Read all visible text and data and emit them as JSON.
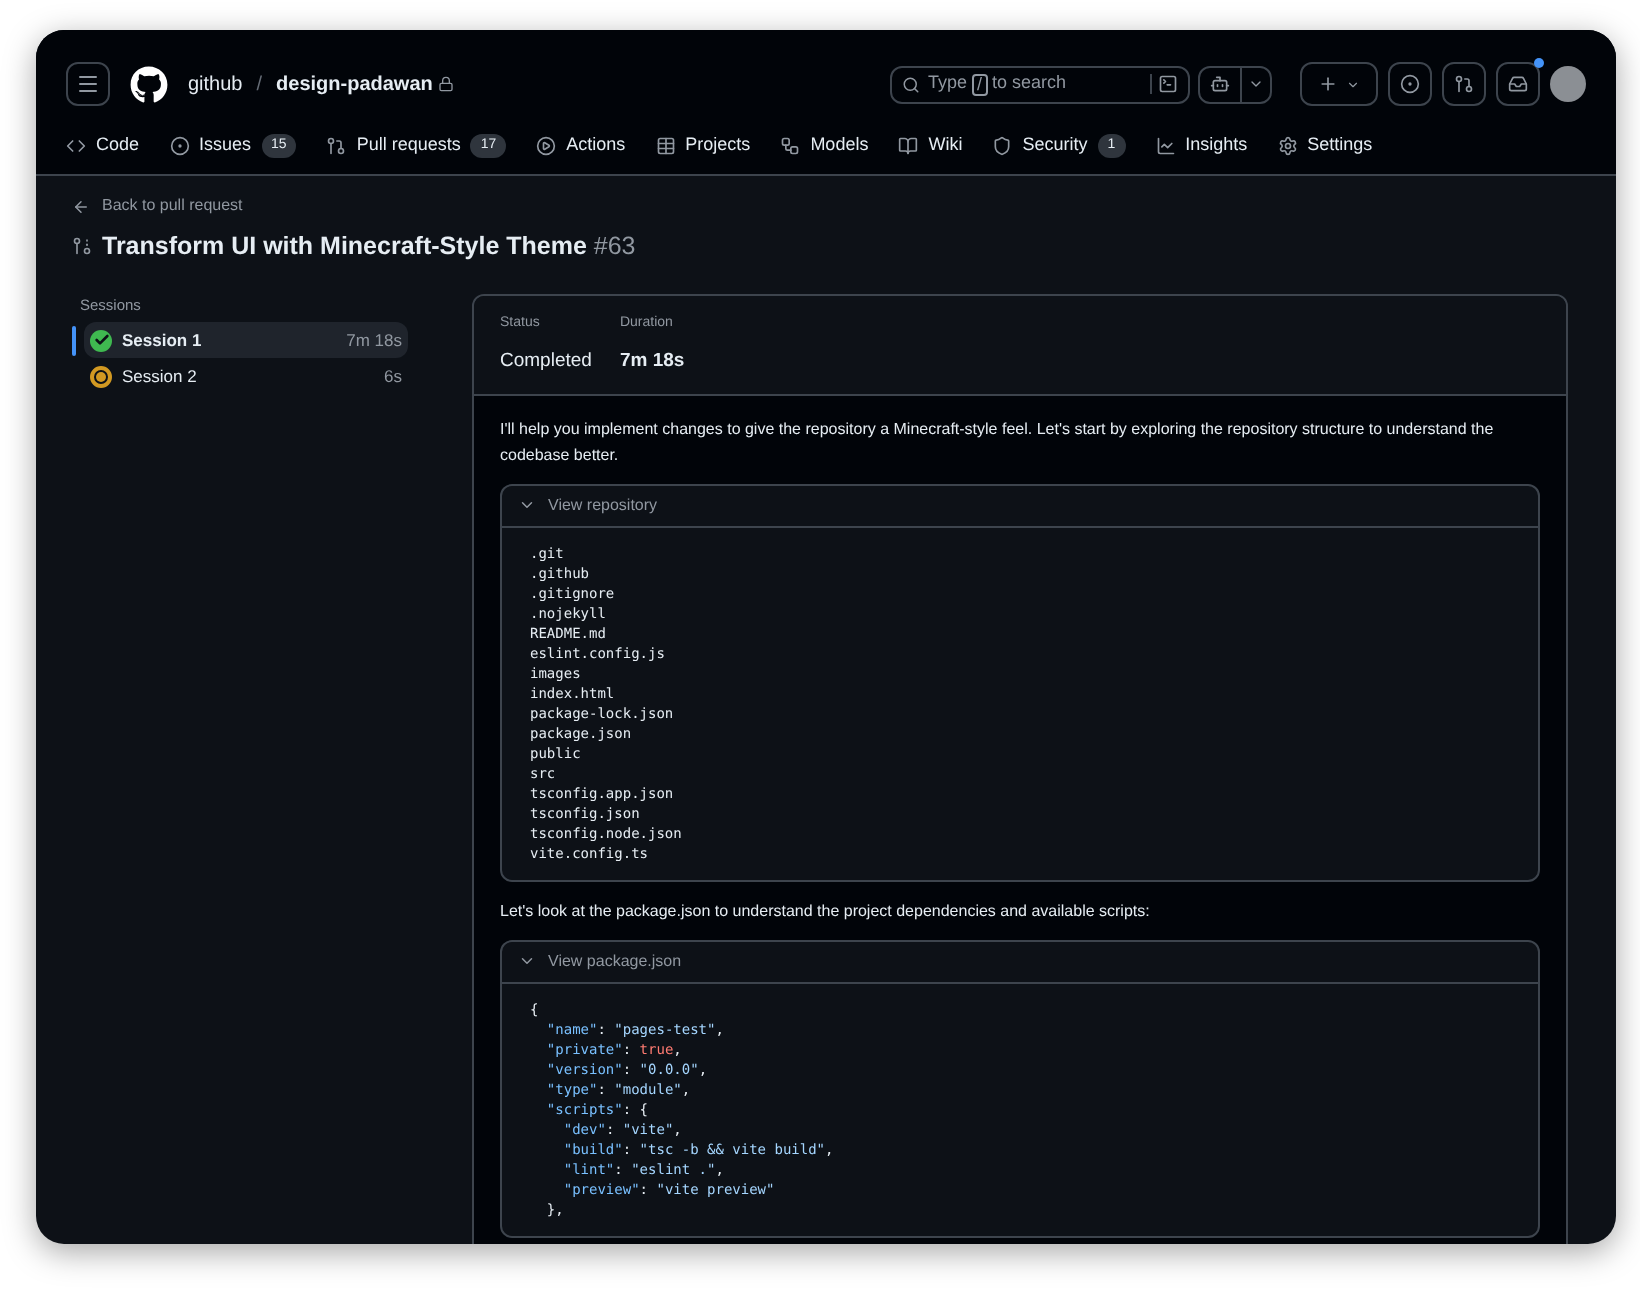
{
  "header": {
    "owner": "github",
    "separator": "/",
    "repo": "design-padawan",
    "search": {
      "before": "Type",
      "key": "/",
      "after": "to search"
    },
    "notifications_unread": true
  },
  "nav": [
    {
      "label": "Code"
    },
    {
      "label": "Issues",
      "count": "15"
    },
    {
      "label": "Pull requests",
      "count": "17"
    },
    {
      "label": "Actions"
    },
    {
      "label": "Projects"
    },
    {
      "label": "Models"
    },
    {
      "label": "Wiki"
    },
    {
      "label": "Security",
      "count": "1"
    },
    {
      "label": "Insights"
    },
    {
      "label": "Settings"
    }
  ],
  "back_link": "Back to pull request",
  "title": {
    "text": "Transform UI with Minecraft-Style Theme",
    "number": "#63"
  },
  "sessions": {
    "heading": "Sessions",
    "items": [
      {
        "name": "Session 1",
        "duration": "7m 18s",
        "kind": "completed",
        "selected": true
      },
      {
        "name": "Session 2",
        "duration": "6s",
        "kind": "in_progress",
        "selected": false
      }
    ]
  },
  "summary": {
    "status_label": "Status",
    "status": "Completed",
    "duration_label": "Duration",
    "duration": "7m 18s"
  },
  "log": [
    {
      "kind": "message",
      "text": "I'll help you implement changes to give the repository a Minecraft-style feel. Let's start by exploring the repository structure to understand the codebase better."
    },
    {
      "kind": "code",
      "title": "View repository",
      "expanded": true,
      "lines": [
        [
          {
            "kind": "plain",
            "text": ".git"
          }
        ],
        [
          {
            "kind": "plain",
            "text": ".github"
          }
        ],
        [
          {
            "kind": "plain",
            "text": ".gitignore"
          }
        ],
        [
          {
            "kind": "plain",
            "text": ".nojekyll"
          }
        ],
        [
          {
            "kind": "plain",
            "text": "README.md"
          }
        ],
        [
          {
            "kind": "plain",
            "text": "eslint.config.js"
          }
        ],
        [
          {
            "kind": "plain",
            "text": "images"
          }
        ],
        [
          {
            "kind": "plain",
            "text": "index.html"
          }
        ],
        [
          {
            "kind": "plain",
            "text": "package-lock.json"
          }
        ],
        [
          {
            "kind": "plain",
            "text": "package.json"
          }
        ],
        [
          {
            "kind": "plain",
            "text": "public"
          }
        ],
        [
          {
            "kind": "plain",
            "text": "src"
          }
        ],
        [
          {
            "kind": "plain",
            "text": "tsconfig.app.json"
          }
        ],
        [
          {
            "kind": "plain",
            "text": "tsconfig.json"
          }
        ],
        [
          {
            "kind": "plain",
            "text": "tsconfig.node.json"
          }
        ],
        [
          {
            "kind": "plain",
            "text": "vite.config.ts"
          }
        ]
      ]
    },
    {
      "kind": "message",
      "text": "Let's look at the package.json to understand the project dependencies and available scripts:"
    },
    {
      "kind": "code",
      "title": "View package.json",
      "expanded": true,
      "lines": [
        [
          {
            "kind": "plain",
            "text": "{"
          }
        ],
        [
          {
            "kind": "key",
            "text": "  \"name\""
          },
          {
            "kind": "plain",
            "text": ": "
          },
          {
            "kind": "string",
            "text": "\"pages-test\""
          },
          {
            "kind": "plain",
            "text": ","
          }
        ],
        [
          {
            "kind": "key",
            "text": "  \"private\""
          },
          {
            "kind": "plain",
            "text": ": "
          },
          {
            "kind": "keyword",
            "text": "true"
          },
          {
            "kind": "plain",
            "text": ","
          }
        ],
        [
          {
            "kind": "key",
            "text": "  \"version\""
          },
          {
            "kind": "plain",
            "text": ": "
          },
          {
            "kind": "string",
            "text": "\"0.0.0\""
          },
          {
            "kind": "plain",
            "text": ","
          }
        ],
        [
          {
            "kind": "key",
            "text": "  \"type\""
          },
          {
            "kind": "plain",
            "text": ": "
          },
          {
            "kind": "string",
            "text": "\"module\""
          },
          {
            "kind": "plain",
            "text": ","
          }
        ],
        [
          {
            "kind": "key",
            "text": "  \"scripts\""
          },
          {
            "kind": "plain",
            "text": ": {"
          }
        ],
        [
          {
            "kind": "key",
            "text": "    \"dev\""
          },
          {
            "kind": "plain",
            "text": ": "
          },
          {
            "kind": "string",
            "text": "\"vite\""
          },
          {
            "kind": "plain",
            "text": ","
          }
        ],
        [
          {
            "kind": "key",
            "text": "    \"build\""
          },
          {
            "kind": "plain",
            "text": ": "
          },
          {
            "kind": "string",
            "text": "\"tsc -b && vite build\""
          },
          {
            "kind": "plain",
            "text": ","
          }
        ],
        [
          {
            "kind": "key",
            "text": "    \"lint\""
          },
          {
            "kind": "plain",
            "text": ": "
          },
          {
            "kind": "string",
            "text": "\"eslint .\""
          },
          {
            "kind": "plain",
            "text": ","
          }
        ],
        [
          {
            "kind": "key",
            "text": "    \"preview\""
          },
          {
            "kind": "plain",
            "text": ": "
          },
          {
            "kind": "string",
            "text": "\"vite preview\""
          }
        ],
        [
          {
            "kind": "plain",
            "text": "  },"
          }
        ]
      ]
    }
  ]
}
